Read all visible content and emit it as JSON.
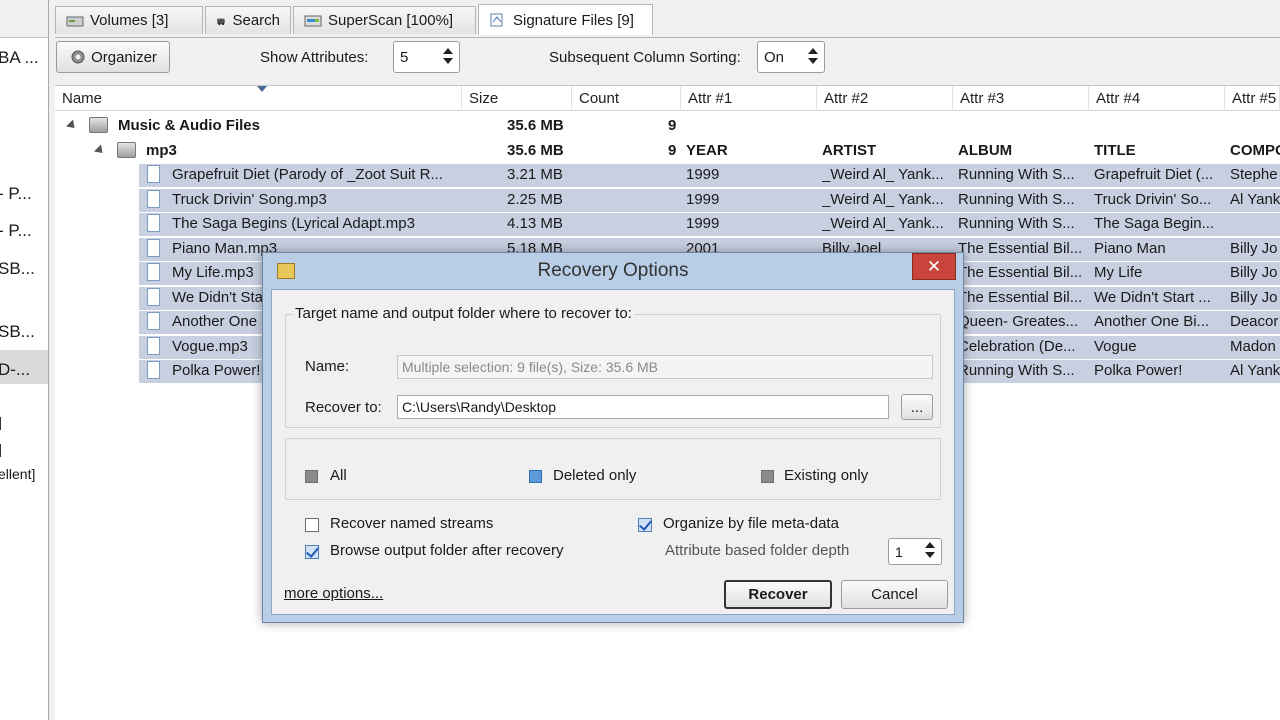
{
  "left_panel": {
    "items": [
      "BA ...",
      "- P...",
      "- P...",
      "SB...",
      "SB...",
      "D-...",
      "]",
      "]",
      "ellent]"
    ]
  },
  "tabs": [
    {
      "label": "Volumes [3]",
      "icon": "volumes-icon"
    },
    {
      "label": "Search",
      "icon": "search-icon"
    },
    {
      "label": "SuperScan [100%]",
      "icon": "superscan-icon"
    },
    {
      "label": "Signature Files [9]",
      "icon": "signature-files-icon"
    }
  ],
  "toolbar": {
    "organizer_label": "Organizer",
    "show_attributes_label": "Show Attributes:",
    "show_attributes_value": "5",
    "subsequent_sorting_label": "Subsequent Column Sorting:",
    "subsequent_sorting_value": "On"
  },
  "table": {
    "columns": [
      "Name",
      "Size",
      "Count",
      "Attr #1",
      "Attr #2",
      "Attr #3",
      "Attr #4",
      "Attr #5"
    ],
    "group": {
      "name": "Music & Audio Files",
      "size": "35.6 MB",
      "count": "9"
    },
    "subgroup": {
      "name": "mp3",
      "size": "35.6 MB",
      "count": "9",
      "attr1": "YEAR",
      "attr2": "ARTIST",
      "attr3": "ALBUM",
      "attr4": "TITLE",
      "attr5": "COMPO"
    },
    "rows": [
      {
        "name": "Grapefruit Diet (Parody of _Zoot Suit R...",
        "size": "3.21 MB",
        "attr1": "1999",
        "attr2": "_Weird Al_ Yank...",
        "attr3": "Running With S...",
        "attr4": "Grapefruit Diet (...",
        "attr5": "Stephe"
      },
      {
        "name": "Truck Drivin' Song.mp3",
        "size": "2.25 MB",
        "attr1": "1999",
        "attr2": "_Weird Al_ Yank...",
        "attr3": "Running With S...",
        "attr4": "Truck Drivin' So...",
        "attr5": "Al Yank"
      },
      {
        "name": "The Saga Begins (Lyrical Adapt.mp3",
        "size": "4.13 MB",
        "attr1": "1999",
        "attr2": "_Weird Al_ Yank...",
        "attr3": "Running With S...",
        "attr4": "The Saga Begin...",
        "attr5": ""
      },
      {
        "name": "Piano Man.mp3",
        "size": "5.18 MB",
        "attr1": "2001",
        "attr2": "Billy Joel",
        "attr3": "The Essential Bil...",
        "attr4": "Piano Man",
        "attr5": "Billy Jo"
      },
      {
        "name": "My Life.mp3",
        "size": "",
        "attr1": "",
        "attr2": "",
        "attr3": "The Essential Bil...",
        "attr4": "My Life",
        "attr5": "Billy Jo"
      },
      {
        "name": "We Didn't Sta",
        "size": "",
        "attr1": "",
        "attr2": "",
        "attr3": "The Essential Bil...",
        "attr4": "We Didn't Start ...",
        "attr5": "Billy Jo"
      },
      {
        "name": "Another One",
        "size": "",
        "attr1": "",
        "attr2": "",
        "attr3": "Queen- Greates...",
        "attr4": "Another One Bi...",
        "attr5": "Deacor"
      },
      {
        "name": "Vogue.mp3",
        "size": "",
        "attr1": "",
        "attr2": "",
        "attr3": "Celebration (De...",
        "attr4": "Vogue",
        "attr5": "Madon"
      },
      {
        "name": "Polka Power!",
        "size": "",
        "attr1": "",
        "attr2": "",
        "attr3": "Running With S...",
        "attr4": "Polka Power!",
        "attr5": "Al Yank"
      }
    ]
  },
  "dialog": {
    "title": "Recovery Options",
    "close_label": "✕",
    "group_label": "Target name and output folder where to recover to:",
    "name_label": "Name:",
    "name_value": "Multiple selection: 9 file(s), Size: 35.6 MB",
    "recover_to_label": "Recover to:",
    "recover_to_value": "C:\\Users\\Randy\\Desktop",
    "browse_label": "...",
    "filter": {
      "all": "All",
      "deleted_only": "Deleted only",
      "existing_only": "Existing only"
    },
    "recover_named_streams": "Recover named streams",
    "browse_output_folder": "Browse output folder after recovery",
    "organize_by_metadata": "Organize by file meta-data",
    "folder_depth_label": "Attribute based folder depth",
    "folder_depth_value": "1",
    "more_options": "more options...",
    "recover_button": "Recover",
    "cancel_button": "Cancel"
  },
  "colors": {
    "selection": "#c7cfe0",
    "dialog_frame": "#b8cde6",
    "close": "#c9443b",
    "highlight": "#d4781e"
  }
}
